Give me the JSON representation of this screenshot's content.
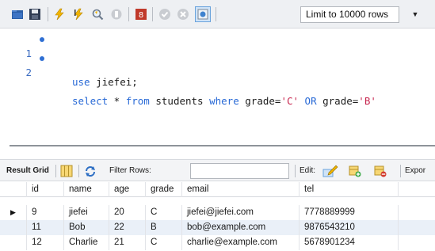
{
  "toolbar": {
    "icons": [
      "open-folder-icon",
      "save-icon",
      "execute-icon",
      "execute-cursor-icon",
      "explain-icon",
      "stop-icon",
      "stop-on-error-icon",
      "commit-icon",
      "rollback-icon",
      "autocommit-icon"
    ],
    "limit_label": "Limit to 10000 rows",
    "limit_arrow": "▼"
  },
  "editor": {
    "lines": [
      {
        "number": "1",
        "parts": [
          {
            "t": "use",
            "c": "kw"
          },
          {
            "t": " jiefei;",
            "c": "id"
          }
        ]
      },
      {
        "number": "2",
        "parts": [
          {
            "t": "select",
            "c": "kw"
          },
          {
            "t": " * ",
            "c": "id"
          },
          {
            "t": "from",
            "c": "kw"
          },
          {
            "t": " students ",
            "c": "id"
          },
          {
            "t": "where",
            "c": "kw"
          },
          {
            "t": " grade=",
            "c": "id"
          },
          {
            "t": "'C'",
            "c": "str"
          },
          {
            "t": " ",
            "c": "id"
          },
          {
            "t": "OR",
            "c": "kw"
          },
          {
            "t": " grade=",
            "c": "id"
          },
          {
            "t": "'B'",
            "c": "str"
          }
        ]
      }
    ]
  },
  "resultbar": {
    "result_grid_label": "Result Grid",
    "filter_label": "Filter Rows:",
    "filter_value": "",
    "edit_label": "Edit:",
    "export_label": "Expor"
  },
  "grid": {
    "columns": [
      "id",
      "name",
      "age",
      "grade",
      "email",
      "tel"
    ],
    "selected_marker": "▶",
    "rows": [
      [
        "9",
        "jiefei",
        "20",
        "C",
        "jiefei@jiefei.com",
        "7778889999"
      ],
      [
        "11",
        "Bob",
        "22",
        "B",
        "bob@example.com",
        "9876543210"
      ],
      [
        "12",
        "Charlie",
        "21",
        "C",
        "charlie@example.com",
        "5678901234"
      ]
    ]
  },
  "colors": {
    "keyword": "#2869d6",
    "string": "#c7254e",
    "alt_row": "#eaf0f8",
    "line_dot": "#2f6fd3"
  }
}
